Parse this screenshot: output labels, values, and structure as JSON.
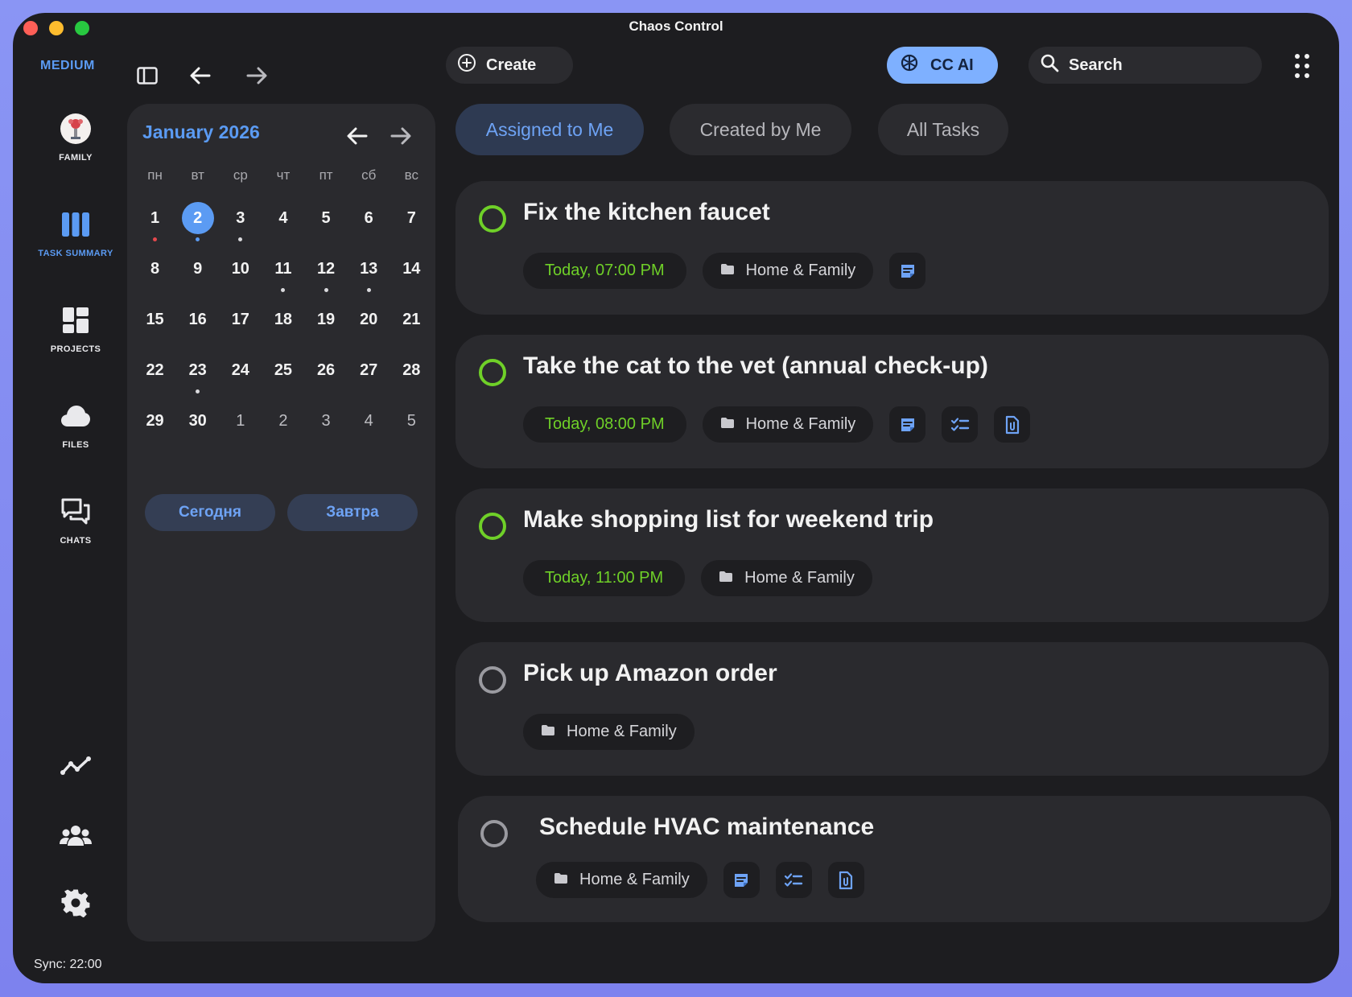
{
  "window": {
    "title": "Chaos Control"
  },
  "toolbar": {
    "plan": "MEDIUM",
    "create_label": "Create",
    "ai_label": "CC AI",
    "search_placeholder": "Search"
  },
  "sidebar": {
    "items": [
      {
        "label": "FAMILY",
        "icon": "family-avatar"
      },
      {
        "label": "TASK SUMMARY",
        "icon": "columns-icon",
        "active": true
      },
      {
        "label": "PROJECTS",
        "icon": "dashboard-icon"
      },
      {
        "label": "FILES",
        "icon": "cloud-icon"
      },
      {
        "label": "CHATS",
        "icon": "chat-icon"
      }
    ],
    "bottom_icons": [
      "analytics-icon",
      "team-icon",
      "settings-icon"
    ],
    "sync": "Sync: 22:00"
  },
  "calendar": {
    "month_title": "January 2026",
    "weekdays": [
      "пн",
      "вт",
      "ср",
      "чт",
      "пт",
      "сб",
      "вс"
    ],
    "weeks": [
      [
        {
          "d": "1",
          "dot": "red"
        },
        {
          "d": "2",
          "dot": "blue",
          "selected": true
        },
        {
          "d": "3",
          "dot": "white"
        },
        {
          "d": "4"
        },
        {
          "d": "5"
        },
        {
          "d": "6"
        },
        {
          "d": "7"
        }
      ],
      [
        {
          "d": "8"
        },
        {
          "d": "9"
        },
        {
          "d": "10"
        },
        {
          "d": "11",
          "dot": "white"
        },
        {
          "d": "12",
          "dot": "white"
        },
        {
          "d": "13",
          "dot": "white"
        },
        {
          "d": "14"
        }
      ],
      [
        {
          "d": "15"
        },
        {
          "d": "16"
        },
        {
          "d": "17"
        },
        {
          "d": "18"
        },
        {
          "d": "19"
        },
        {
          "d": "20"
        },
        {
          "d": "21"
        }
      ],
      [
        {
          "d": "22"
        },
        {
          "d": "23",
          "dot": "white"
        },
        {
          "d": "24"
        },
        {
          "d": "25"
        },
        {
          "d": "26"
        },
        {
          "d": "27"
        },
        {
          "d": "28"
        }
      ],
      [
        {
          "d": "29"
        },
        {
          "d": "30"
        },
        {
          "d": "1",
          "other": true
        },
        {
          "d": "2",
          "other": true
        },
        {
          "d": "3",
          "other": true
        },
        {
          "d": "4",
          "other": true
        },
        {
          "d": "5",
          "other": true
        }
      ]
    ],
    "today_label": "Сегодня",
    "tomorrow_label": "Завтра"
  },
  "tabs": [
    {
      "label": "Assigned to Me",
      "active": true
    },
    {
      "label": "Created by Me"
    },
    {
      "label": "All Tasks"
    }
  ],
  "tasks": [
    {
      "title": "Fix the kitchen faucet",
      "due": "Today, 07:00 PM",
      "project": "Home & Family",
      "attachments": [
        "notes-icon"
      ]
    },
    {
      "title": "Take the cat to the vet (annual check-up)",
      "due": "Today, 08:00 PM",
      "project": "Home & Family",
      "attachments": [
        "notes-icon",
        "checklist-icon",
        "file-icon"
      ]
    },
    {
      "title": "Make shopping list for weekend trip",
      "due": "Today, 11:00 PM",
      "project": "Home & Family",
      "attachments": []
    },
    {
      "title": "Pick up Amazon order",
      "due": "",
      "project": "Home & Family",
      "attachments": []
    },
    {
      "title": "Schedule HVAC maintenance",
      "due": "",
      "project": "Home & Family",
      "attachments": [
        "notes-icon",
        "checklist-icon",
        "file-icon"
      ]
    }
  ],
  "colors": {
    "accent": "#5b9bf3",
    "due_green": "#6fd028",
    "ai_button": "#7eb0ff",
    "background": "#1d1d20",
    "panel": "#2a2a2e"
  }
}
